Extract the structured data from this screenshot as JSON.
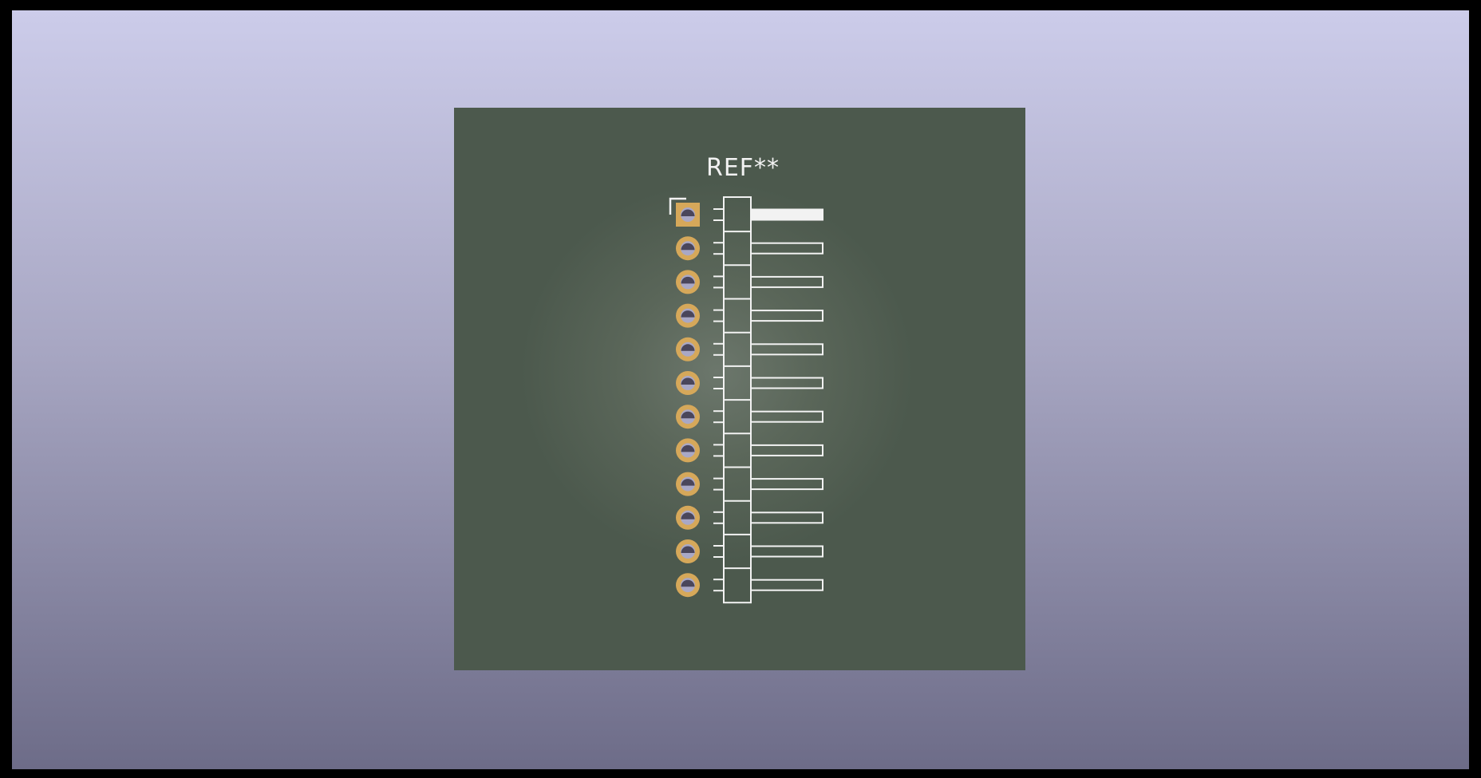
{
  "viewer": {
    "mode": "3d-footprint-preview"
  },
  "board": {
    "reference_label": "REF**",
    "pin_count": 12,
    "colors": {
      "background_top": "#ccccea",
      "background_bottom": "#6d6c88",
      "soldermask": "#4c594d",
      "copper_pad": "#d6a85a",
      "silkscreen": "#f2f2f2",
      "hole": "#a9a8c6"
    },
    "icons": {
      "pad": "through-hole-pad-icon",
      "pin1": "square-pad-icon"
    }
  }
}
